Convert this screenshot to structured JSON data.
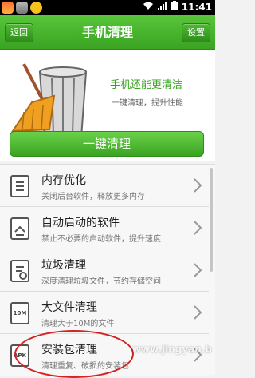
{
  "status_bar": {
    "time": "11:41",
    "icons": [
      "app-icon-1",
      "app-icon-2",
      "app-icon-3",
      "wifi-icon",
      "signal-icon",
      "battery-icon"
    ]
  },
  "header": {
    "title": "手机清理",
    "back_label": "返回",
    "settings_label": "设置"
  },
  "hero": {
    "headline": "手机还能更清洁",
    "subline": "一键清理，提升性能",
    "image_icon": "trash-can-broom-illustration"
  },
  "main_button": {
    "label": "一键清理"
  },
  "list_items": [
    {
      "title": "内存优化",
      "subtitle": "关闭后台软件，释放更多内存",
      "icon": "memory-icon"
    },
    {
      "title": "自动启动的软件",
      "subtitle": "禁止不必要的启动软件，提升速度",
      "icon": "autostart-icon"
    },
    {
      "title": "垃圾清理",
      "subtitle": "深度清理垃圾文件，节约存储空间",
      "icon": "junk-icon"
    },
    {
      "title": "大文件清理",
      "subtitle": "清理大于10M的文件",
      "icon": "large-file-icon",
      "icon_text": "10M"
    },
    {
      "title": "安装包清理",
      "subtitle": "清理重复、破损的安装包",
      "icon": "apk-icon",
      "icon_text": "APK"
    }
  ],
  "colors": {
    "accent": "#3aa423",
    "annotation": "#d32222"
  },
  "watermark": "www.jingyan.b"
}
